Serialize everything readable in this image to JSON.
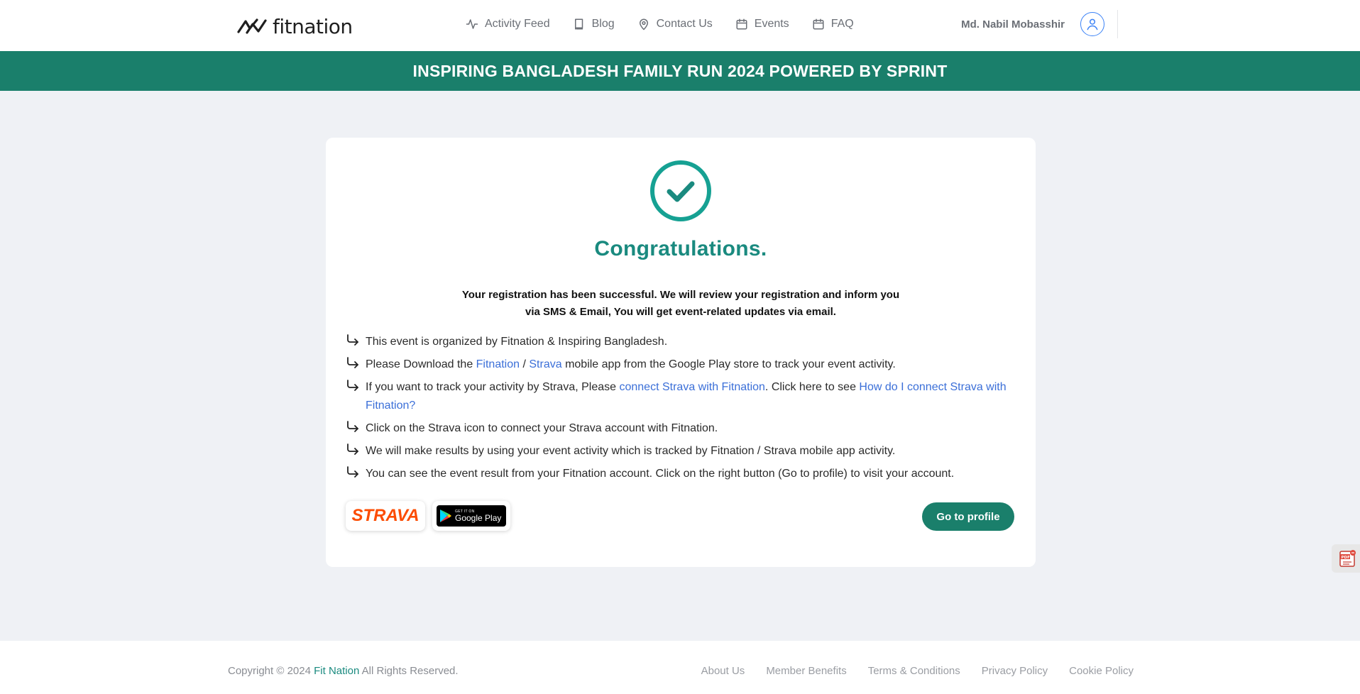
{
  "header": {
    "logo_text": "fitnation",
    "nav": [
      {
        "label": "Activity Feed",
        "icon": "activity-icon"
      },
      {
        "label": "Blog",
        "icon": "book-icon"
      },
      {
        "label": "Contact Us",
        "icon": "map-pin-icon"
      },
      {
        "label": "Events",
        "icon": "calendar-icon"
      },
      {
        "label": "FAQ",
        "icon": "calendar-icon"
      }
    ],
    "user_name": "Md. Nabil Mobasshir",
    "avatar_icon": "user-icon"
  },
  "banner": {
    "title": "INSPIRING BANGLADESH FAMILY RUN 2024 POWERED BY SPRINT"
  },
  "card": {
    "icon": "check-circle-icon",
    "title": "Congratulations.",
    "message_line1": "Your registration has been successful. We will review your registration and inform you",
    "message_line2": "via SMS & Email, You will get event-related updates via email.",
    "items": {
      "i1": "This event is organized by Fitnation & Inspiring Bangladesh.",
      "i2_a": "Please Download the ",
      "i2_link1": "Fitnation",
      "i2_b": " / ",
      "i2_link2": "Strava",
      "i2_c": " mobile app from the Google Play store to track your event activity.",
      "i3_a": "If you want to track your activity by Strava, Please ",
      "i3_link1": "connect Strava with Fitnation",
      "i3_b": ". Click here to see ",
      "i3_link2": "How do I connect Strava with Fitnation?",
      "i4": "Click on the Strava icon to connect your Strava account with Fitnation.",
      "i5": "We will make results by using your event activity which is tracked by Fitnation / Strava mobile app activity.",
      "i6": "You can see the event result from your Fitnation account. Click on the right button (Go to profile) to visit your account."
    },
    "strava_badge": "STRAVA",
    "gplay_small": "GET IT ON",
    "gplay_big": "Google Play",
    "profile_button": "Go to profile"
  },
  "pdf_widget_icon": "pdf-icon",
  "footer": {
    "copyright_prefix": "Copyright © 2024 ",
    "copyright_brand": "Fit Nation",
    "copyright_suffix": " All Rights Reserved.",
    "links": [
      "About Us",
      "Member Benefits",
      "Terms & Conditions",
      "Privacy Policy",
      "Cookie Policy"
    ]
  },
  "colors": {
    "primary": "#1a7f6b",
    "accent_teal": "#1a8a7f",
    "link": "#3b6fd8",
    "strava": "#fc4c02",
    "page_bg": "#eff1f5"
  }
}
